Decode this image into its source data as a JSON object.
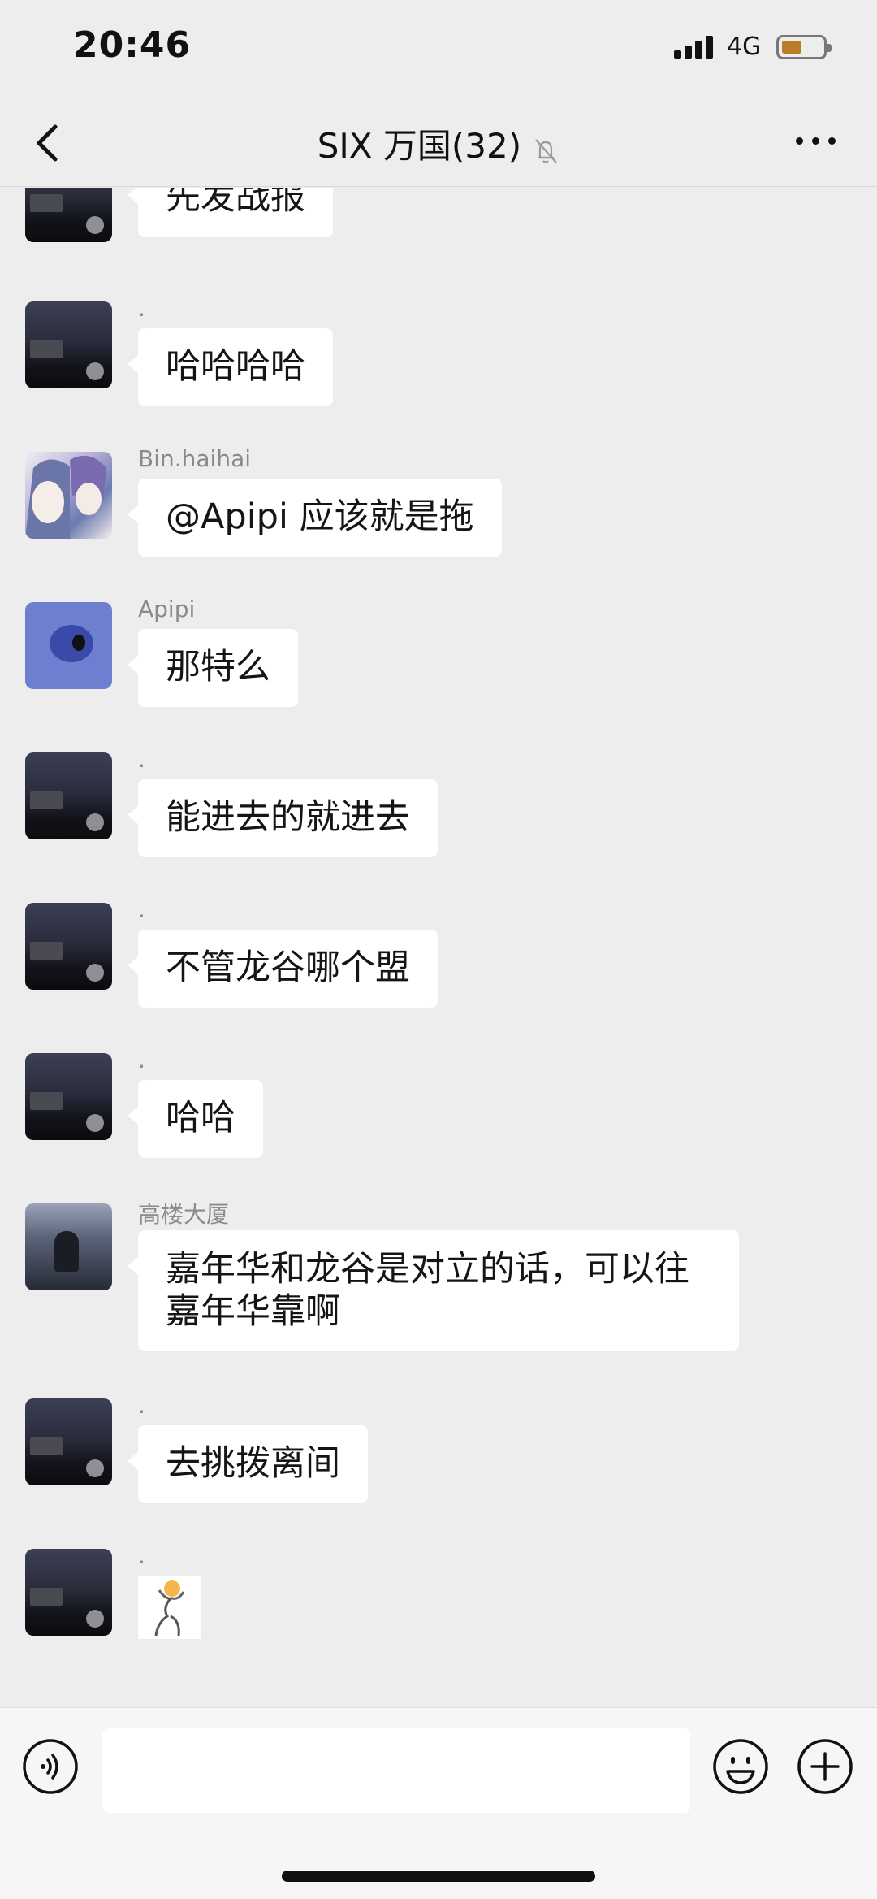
{
  "status_bar": {
    "time": "20:46",
    "network": "4G",
    "battery_color": "#b87c2a"
  },
  "nav": {
    "title": "SIX 万国(32)",
    "muted_icon": "bell-muted-icon",
    "back_icon": "chevron-left-icon",
    "more_icon": "more-dots-icon"
  },
  "messages": [
    {
      "sender": "",
      "avatar": "night-street-avatar",
      "text": "先发战报"
    },
    {
      "sender": ".",
      "avatar": "night-street-avatar",
      "text": "哈哈哈哈"
    },
    {
      "sender": "Bin.haihai",
      "avatar": "anime-couple-avatar",
      "text": "@Apipi 应该就是拖"
    },
    {
      "sender": "Apipi",
      "avatar": "stitch-avatar",
      "text": "那特么"
    },
    {
      "sender": ".",
      "avatar": "night-street-avatar",
      "text": "能进去的就进去"
    },
    {
      "sender": ".",
      "avatar": "night-street-avatar",
      "text": "不管龙谷哪个盟"
    },
    {
      "sender": ".",
      "avatar": "night-street-avatar",
      "text": "哈哈"
    },
    {
      "sender": "高楼大厦",
      "avatar": "street-person-avatar",
      "text": "嘉年华和龙谷是对立的话，可以往嘉年华靠啊"
    },
    {
      "sender": ".",
      "avatar": "night-street-avatar",
      "text": "去挑拨离间"
    },
    {
      "sender": ".",
      "avatar": "night-street-avatar",
      "sticker": "dancing-figure-sticker"
    }
  ],
  "input_bar": {
    "voice_icon": "voice-icon",
    "emoji_icon": "emoji-icon",
    "plus_icon": "plus-icon",
    "value": ""
  }
}
